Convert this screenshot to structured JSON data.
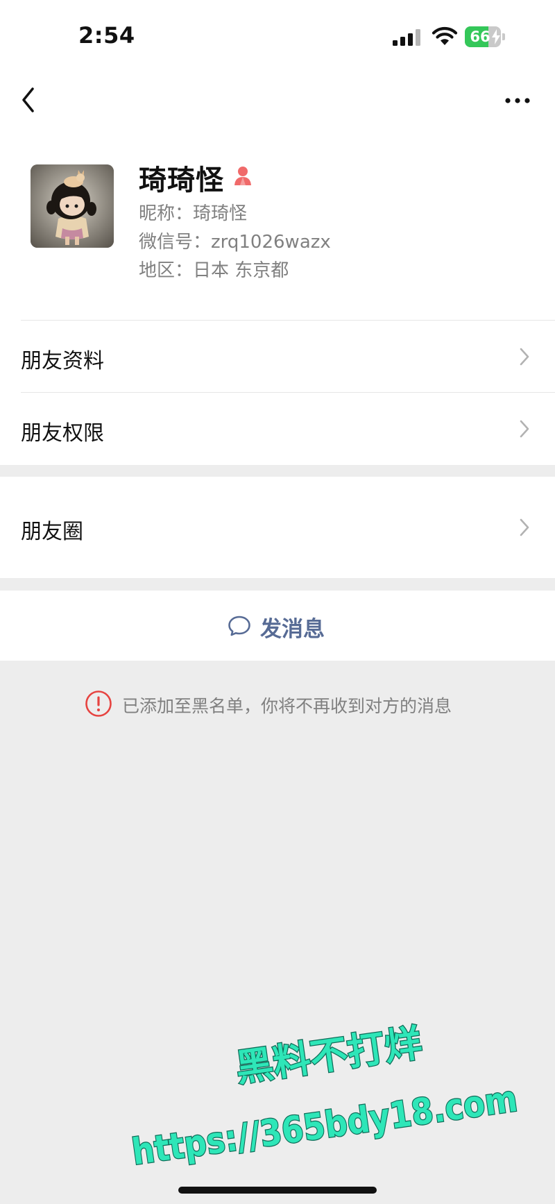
{
  "status_bar": {
    "time": "2:54",
    "battery_level": 66,
    "battery_text": "66",
    "charging": true,
    "icons": [
      "signal-icon",
      "wifi-icon",
      "battery-icon"
    ],
    "battery_color": "#34c759"
  },
  "nav": {
    "icons": [
      "chevron-left-icon",
      "more-icon"
    ]
  },
  "profile": {
    "display_name": "琦琦怪",
    "gender_icon": "female-icon",
    "gender_color": "#e64340",
    "nickname": "昵称：琦琦怪",
    "wechat_id": "微信号：zrq1026wazx",
    "region": "地区：日本 东京都"
  },
  "rows": {
    "friend_profile": "朋友资料",
    "friend_permissions": "朋友权限",
    "moments": "朋友圈"
  },
  "send_message": {
    "label": "发消息",
    "icon": "chat-bubble-icon",
    "color": "#576b95"
  },
  "notice": {
    "text": "已添加至黑名单，你将不再收到对方的消息",
    "icon": "exclamation-circle-icon",
    "icon_color": "#e64340"
  },
  "watermark": {
    "line1": "黑料不打烊",
    "line2": "https://365bdy18.com",
    "color": "#2ee6b8"
  }
}
